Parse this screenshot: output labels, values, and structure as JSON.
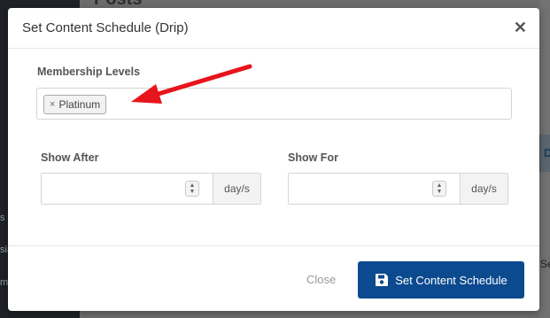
{
  "background": {
    "page_title": "Posts",
    "sidebar_fragments": [
      "s",
      "sia",
      "m"
    ],
    "right_tab_fragment": "D",
    "right_text_fragment": "Se"
  },
  "modal": {
    "title": "Set Content Schedule (Drip)",
    "close_icon": "close-icon",
    "membership": {
      "label": "Membership Levels",
      "tags": [
        {
          "remove_symbol": "×",
          "label": "Platinum"
        }
      ]
    },
    "show_after": {
      "label": "Show After",
      "value": "",
      "unit": "day/s"
    },
    "show_for": {
      "label": "Show For",
      "value": "",
      "unit": "day/s"
    },
    "footer": {
      "close_label": "Close",
      "submit_label": "Set Content Schedule",
      "submit_icon": "floppy-disk-icon"
    }
  },
  "annotation": {
    "arrow_color": "#e8141b",
    "accent": "#0c4a8f"
  }
}
